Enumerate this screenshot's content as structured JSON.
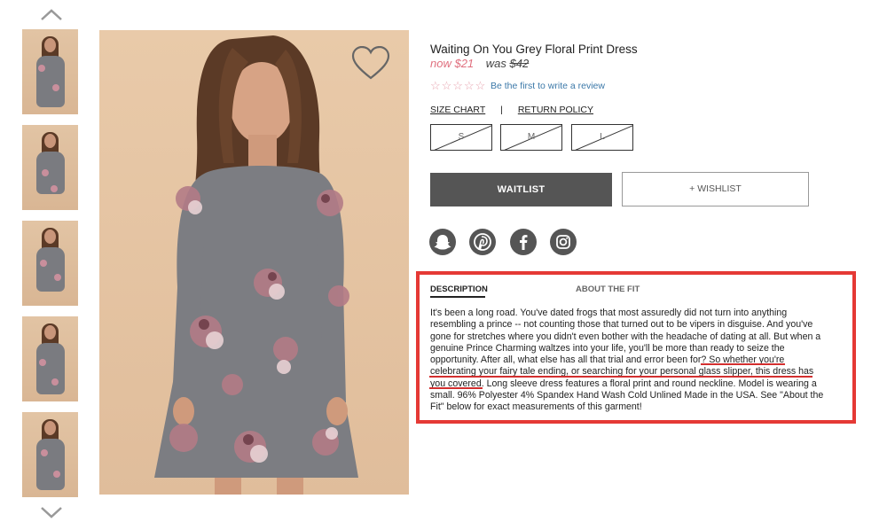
{
  "product": {
    "title": "Waiting On You Grey Floral Print Dress",
    "now_price": "now $21",
    "was_label": "was",
    "was_price": "$42",
    "stars": "☆☆☆☆☆",
    "review_link": "Be the first to write a review"
  },
  "links": {
    "size_chart": "SIZE CHART",
    "separator": "|",
    "return_policy": "RETURN POLICY"
  },
  "sizes": [
    "S",
    "M",
    "L"
  ],
  "buttons": {
    "waitlist": "WAITLIST",
    "wishlist": "+ WISHLIST"
  },
  "social": [
    "snapchat-icon",
    "pinterest-icon",
    "facebook-icon",
    "instagram-icon"
  ],
  "tabs": {
    "description": "DESCRIPTION",
    "fit": "ABOUT THE FIT"
  },
  "description": "It's been a long road. You've dated frogs that most assuredly did not turn into anything resembling a prince -- not counting those that turned out to be vipers in disguise. And you've gone for stretches where you didn't even bother with the headache of dating at all. But when a genuine Prince Charming waltzes into your life, you'll be more than ready to seize the opportunity. After all, what else has all that trial and error been for? So whether you're celebrating your fairy tale ending, or searching for your personal glass slipper, this dress has you covered. Long sleeve dress features a floral print and round neckline. Model is wearing a small.      96% Polyester 4% Spandex Hand Wash Cold Unlined Made in the USA. See \"About the Fit\" below for exact measurements of this garment!",
  "colors": {
    "accent_red": "#e53935",
    "price_pink": "#e0707f",
    "link_blue": "#3b78a8",
    "button_grey": "#555555"
  }
}
